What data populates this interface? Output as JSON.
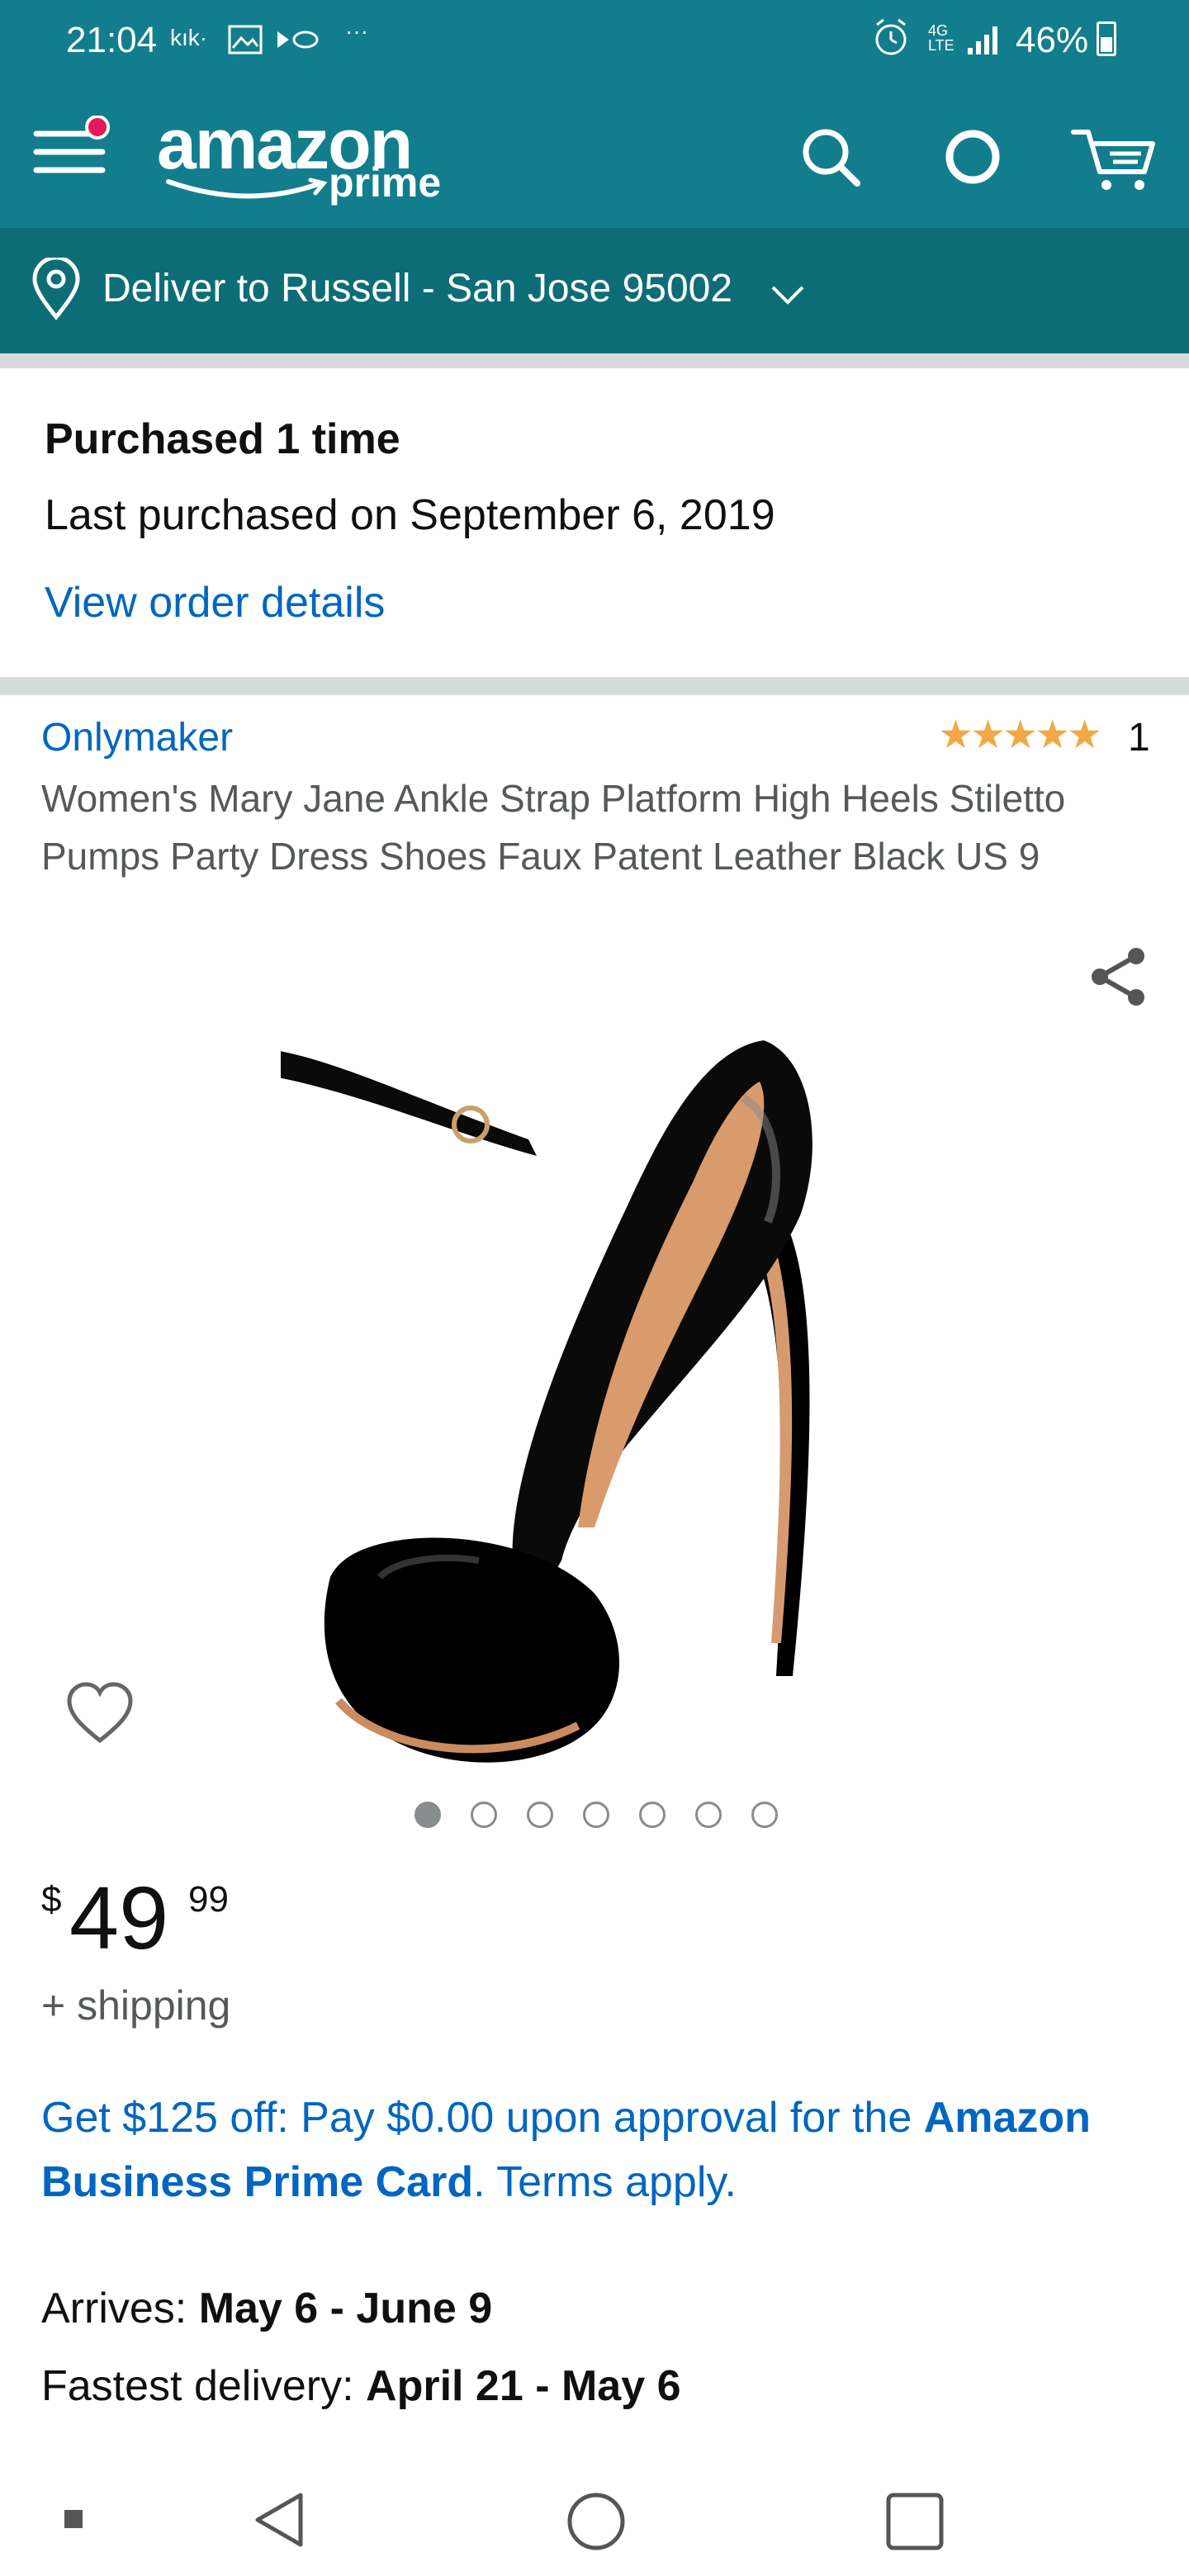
{
  "status_bar": {
    "time": "21:04",
    "carrier": "kık·",
    "more": "···",
    "network": "4G LTE",
    "battery": "46%"
  },
  "header": {
    "logo_main": "amazon",
    "logo_sub": "prime",
    "icons": [
      "menu-icon",
      "search-icon",
      "alexa-icon",
      "cart-icon"
    ]
  },
  "deliver": {
    "text": "Deliver to Russell - San Jose 95002"
  },
  "purchase_history": {
    "count_text": "Purchased 1 time",
    "last_purchased": "Last purchased on September 6, 2019",
    "link": "View order details"
  },
  "product": {
    "brand": "Onlymaker",
    "stars": "★★★★★",
    "rating_count": "1",
    "title": "Women's Mary Jane Ankle Strap Platform High Heels Stiletto Pumps Party Dress Shoes Faux Patent Leather Black US 9",
    "image_count": 7,
    "active_image": 0,
    "price_symbol": "$",
    "price_whole": "49",
    "price_fraction": "99",
    "shipping": "+ shipping"
  },
  "promo": {
    "part1": "Get $125 off: Pay $0.00 upon approval for the ",
    "bold": "Amazon Business Prime Card",
    "part2": ". Terms apply."
  },
  "delivery": {
    "arrives_label": "Arrives: ",
    "arrives_value": "May 6 - June 9",
    "fastest_label": "Fastest delivery: ",
    "fastest_value": "April 21 - May 6"
  },
  "colors": {
    "header": "#127e8d",
    "deliver_bar": "#0d6d77",
    "link": "#0066c0",
    "star": "#f3a847"
  }
}
